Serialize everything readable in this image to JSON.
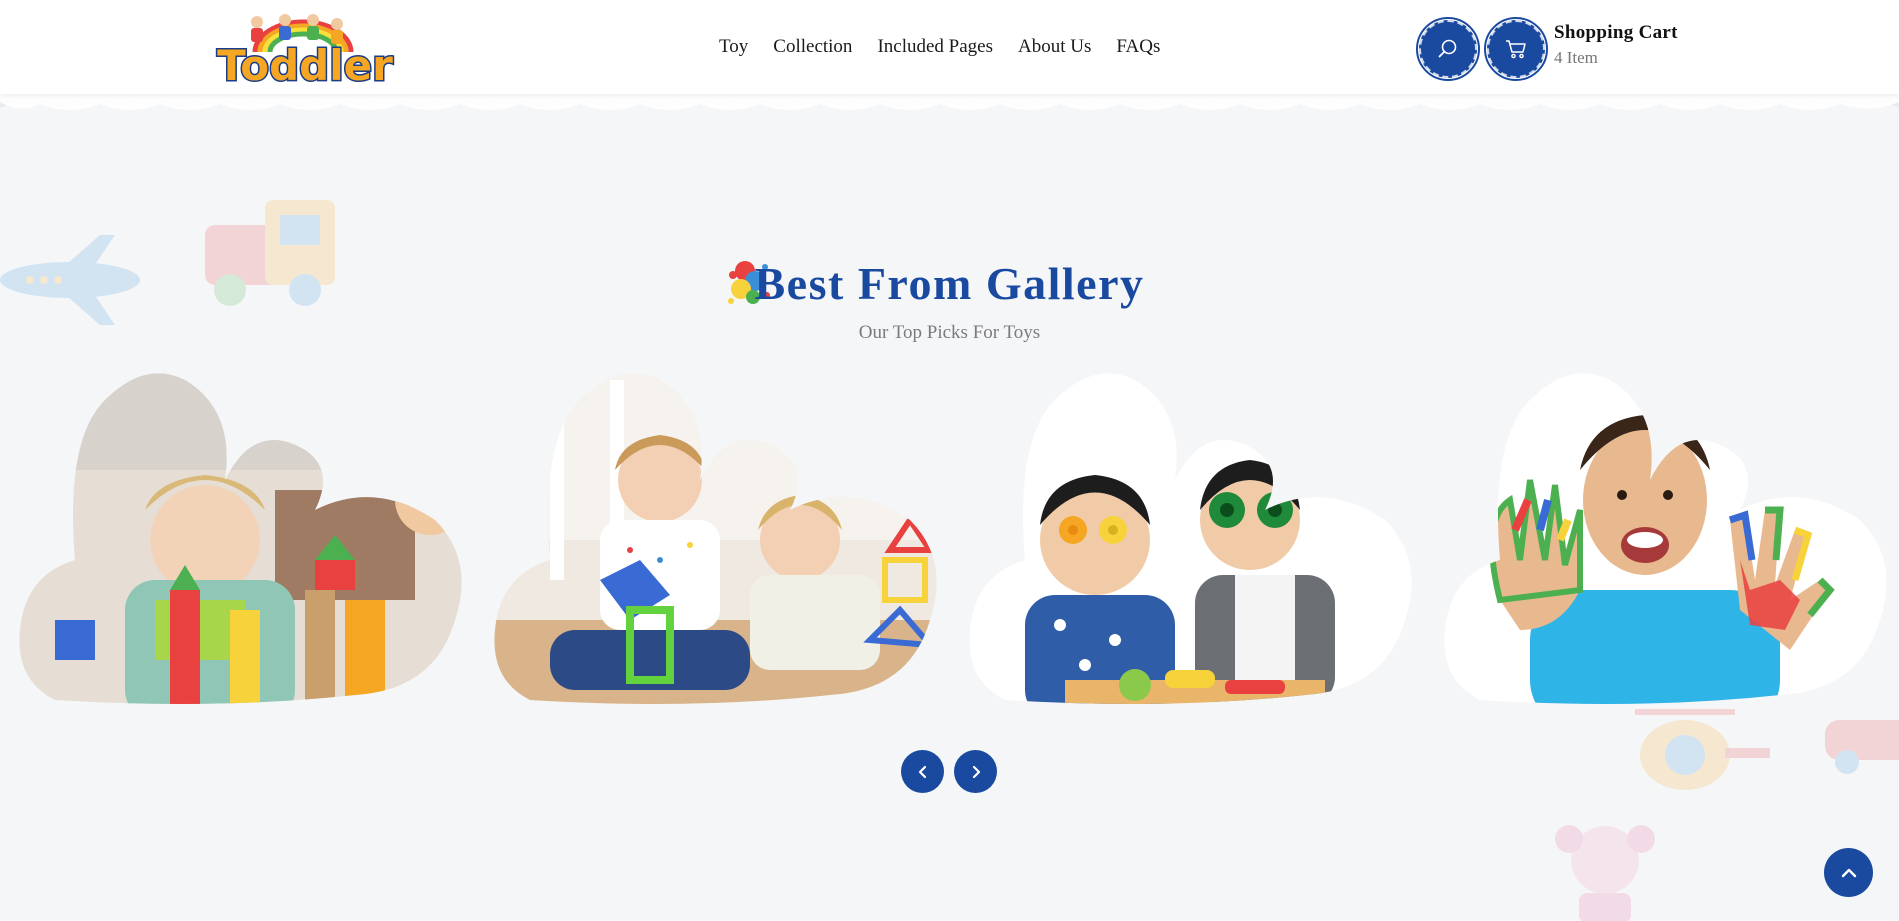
{
  "header": {
    "logo_text": "Toddler",
    "nav": [
      "Toy",
      "Collection",
      "Included Pages",
      "About Us",
      "FAQs"
    ],
    "cart": {
      "title": "Shopping Cart",
      "count": "4 Item"
    }
  },
  "section": {
    "title": "Best From Gallery",
    "subtitle": "Our Top Picks For Toys"
  },
  "gallery": [
    {
      "name": "toddler-blocks",
      "bg": "#e9e3dc",
      "accent": "#c44"
    },
    {
      "name": "girl-boy-magnetic-tiles",
      "bg": "#ece8e2",
      "accent": "#3a6ad4"
    },
    {
      "name": "kids-toy-binoculars",
      "bg": "#ffffff",
      "accent": "#2c8a3a"
    },
    {
      "name": "boy-painted-hands",
      "bg": "#ffffff",
      "accent": "#29a9e0"
    }
  ],
  "colors": {
    "primary": "#1a4aa0",
    "background": "#f5f6f8",
    "logo_orange": "#f5a623"
  },
  "icons": {
    "search": "search-icon",
    "cart": "cart-icon",
    "prev": "chevron-left-icon",
    "next": "chevron-right-icon",
    "top": "chevron-up-icon"
  }
}
